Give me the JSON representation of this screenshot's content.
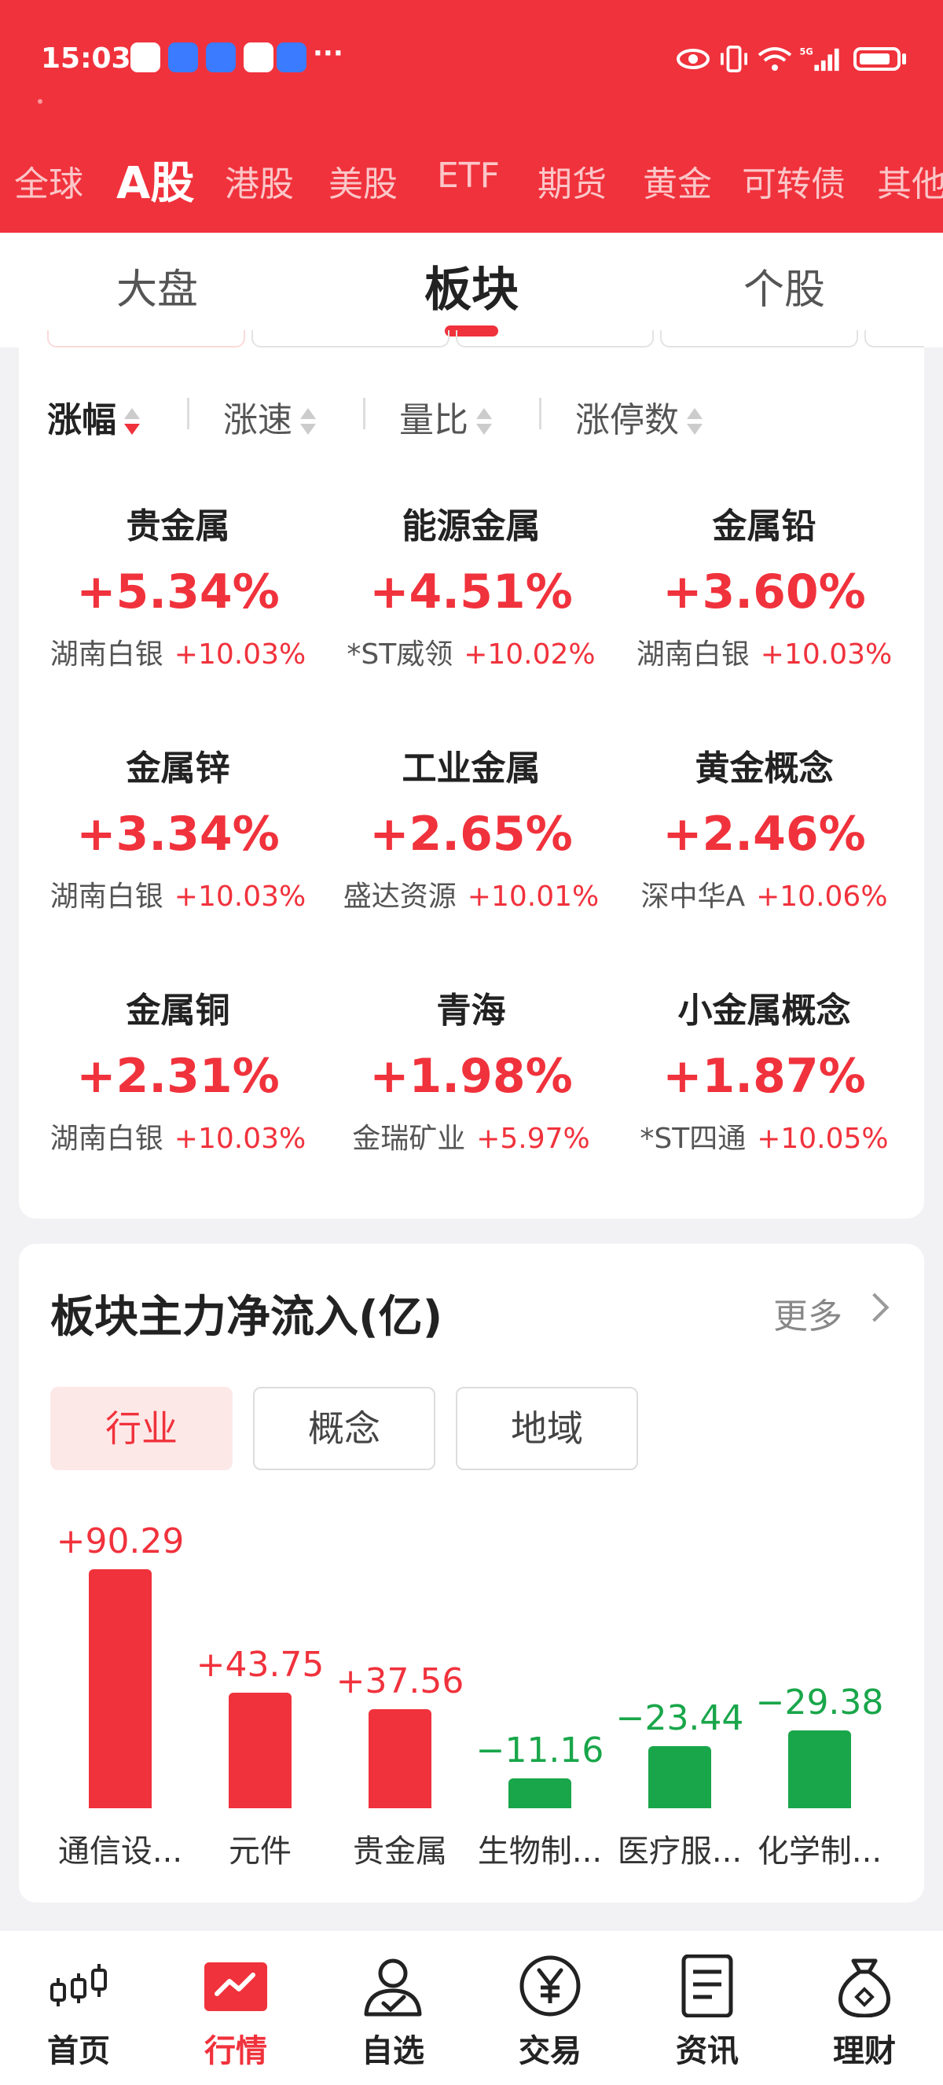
{
  "status_bar": {
    "time": "15:03"
  },
  "market_tabs": [
    "全球",
    "A股",
    "港股",
    "美股",
    "ETF",
    "期货",
    "黄金",
    "可转债",
    "其他"
  ],
  "market_active": "A股",
  "sub_tabs": [
    "大盘",
    "板块",
    "个股"
  ],
  "sub_active": "板块",
  "sort_options": [
    "涨幅",
    "涨速",
    "量比",
    "涨停数"
  ],
  "sectors": [
    {
      "name": "贵金属",
      "pct": "+5.34%",
      "leader": "湖南白银",
      "leader_pct": "+10.03%"
    },
    {
      "name": "能源金属",
      "pct": "+4.51%",
      "leader": "*ST威领",
      "leader_pct": "+10.02%"
    },
    {
      "name": "金属铅",
      "pct": "+3.60%",
      "leader": "湖南白银",
      "leader_pct": "+10.03%"
    },
    {
      "name": "金属锌",
      "pct": "+3.34%",
      "leader": "湖南白银",
      "leader_pct": "+10.03%"
    },
    {
      "name": "工业金属",
      "pct": "+2.65%",
      "leader": "盛达资源",
      "leader_pct": "+10.01%"
    },
    {
      "name": "黄金概念",
      "pct": "+2.46%",
      "leader": "深中华A",
      "leader_pct": "+10.06%"
    },
    {
      "name": "金属铜",
      "pct": "+2.31%",
      "leader": "湖南白银",
      "leader_pct": "+10.03%"
    },
    {
      "name": "青海",
      "pct": "+1.98%",
      "leader": "金瑞矿业",
      "leader_pct": "+5.97%"
    },
    {
      "name": "小金属概念",
      "pct": "+1.87%",
      "leader": "*ST四通",
      "leader_pct": "+10.05%"
    }
  ],
  "flow_section": {
    "title": "板块主力净流入(亿)",
    "more_label": "更多",
    "filter_tabs": [
      "行业",
      "概念",
      "地域"
    ],
    "filter_active": "行业"
  },
  "chart_data": {
    "type": "bar",
    "categories": [
      "通信设...",
      "元件",
      "贵金属",
      "生物制...",
      "医疗服...",
      "化学制..."
    ],
    "values": [
      90.29,
      43.75,
      37.56,
      -11.16,
      -23.44,
      -29.38
    ],
    "value_labels": [
      "+90.29",
      "+43.75",
      "+37.56",
      "−11.16",
      "−23.44",
      "−29.38"
    ],
    "colors": {
      "positive": "#f0323c",
      "negative": "#19a64a"
    }
  },
  "bottom_nav": [
    "首页",
    "行情",
    "自选",
    "交易",
    "资讯",
    "理财"
  ],
  "bottom_active": "行情",
  "colors": {
    "accent": "#f0323c",
    "down": "#19a64a"
  }
}
